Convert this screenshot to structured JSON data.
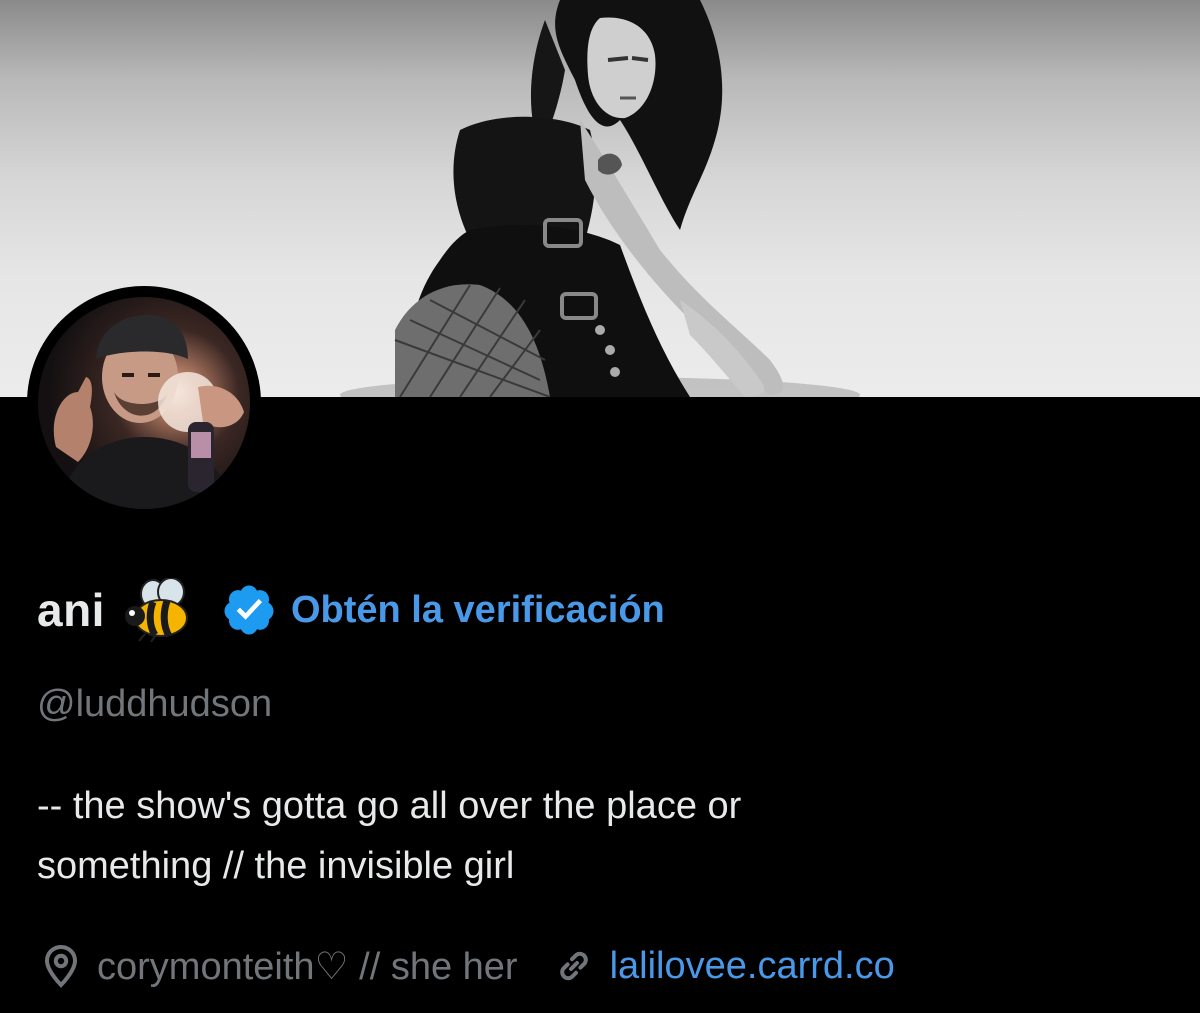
{
  "profile": {
    "display_name": "ani",
    "name_emoji": "bee-emoji",
    "verification_link": "Obtén la verificación",
    "handle": "@luddhudson",
    "bio": "-- the show's gotta go all over the place or\nsomething // the invisible girl",
    "location": "corymonteith♡ // she her",
    "website": "lalilovee.carrd.co"
  },
  "icons": {
    "verified": "verified-badge-icon",
    "location": "location-pin-icon",
    "link": "link-icon"
  },
  "colors": {
    "background": "#000000",
    "primary_text": "#e7e9ea",
    "secondary_text": "#71767b",
    "accent": "#4a99e9",
    "badge": "#1d9bf0"
  }
}
